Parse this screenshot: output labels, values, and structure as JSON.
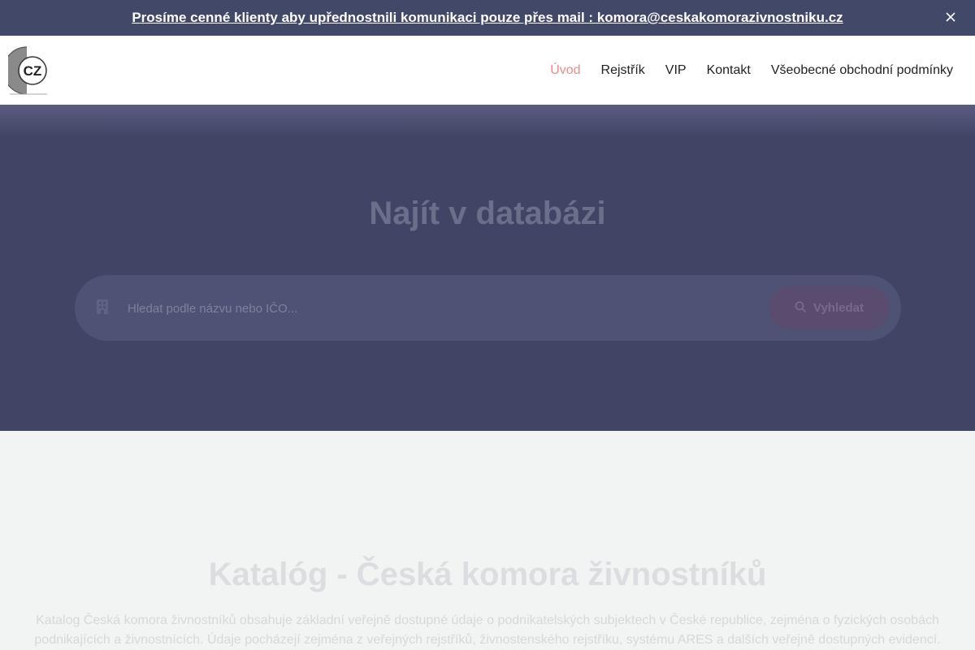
{
  "announcement": {
    "text": "Prosíme cenné klienty aby upřednostnili komunikaci pouze přes mail : komora@ceskakomorazivnostniku.cz",
    "close_icon": "close-icon"
  },
  "header": {
    "logo_text": "CZ",
    "nav": [
      {
        "label": "Úvod",
        "active": true
      },
      {
        "label": "Rejstřík",
        "active": false
      },
      {
        "label": "VIP",
        "active": false
      },
      {
        "label": "Kontakt",
        "active": false
      },
      {
        "label": "Všeobecné obchodní podmínky",
        "active": false
      }
    ]
  },
  "hero": {
    "title": "Najít v databázi",
    "search": {
      "placeholder": "Hledat podle názvu nebo IČO...",
      "value": "",
      "icon": "building-icon",
      "button_label": "Vyhledat",
      "button_icon": "search-icon"
    }
  },
  "content": {
    "title": "Katalóg - Česká komora živnostníků",
    "description": "Katalog Česká komora živnostníků obsahuje základní veřejně dostupné údaje o podnikatelských subjektech v České republice, zejména o fyzických osobách podnikajících a živnostnících. Údaje pocházejí zejména z veřejných rejstříků, živnostenského rejstříku, systému ARES a dalších veřejně dostupných evidencí."
  },
  "colors": {
    "announcement_bg": "#424868",
    "hero_bg": "#404465",
    "nav_active": "#e78b8b",
    "page_bg": "#f2f4f3"
  }
}
